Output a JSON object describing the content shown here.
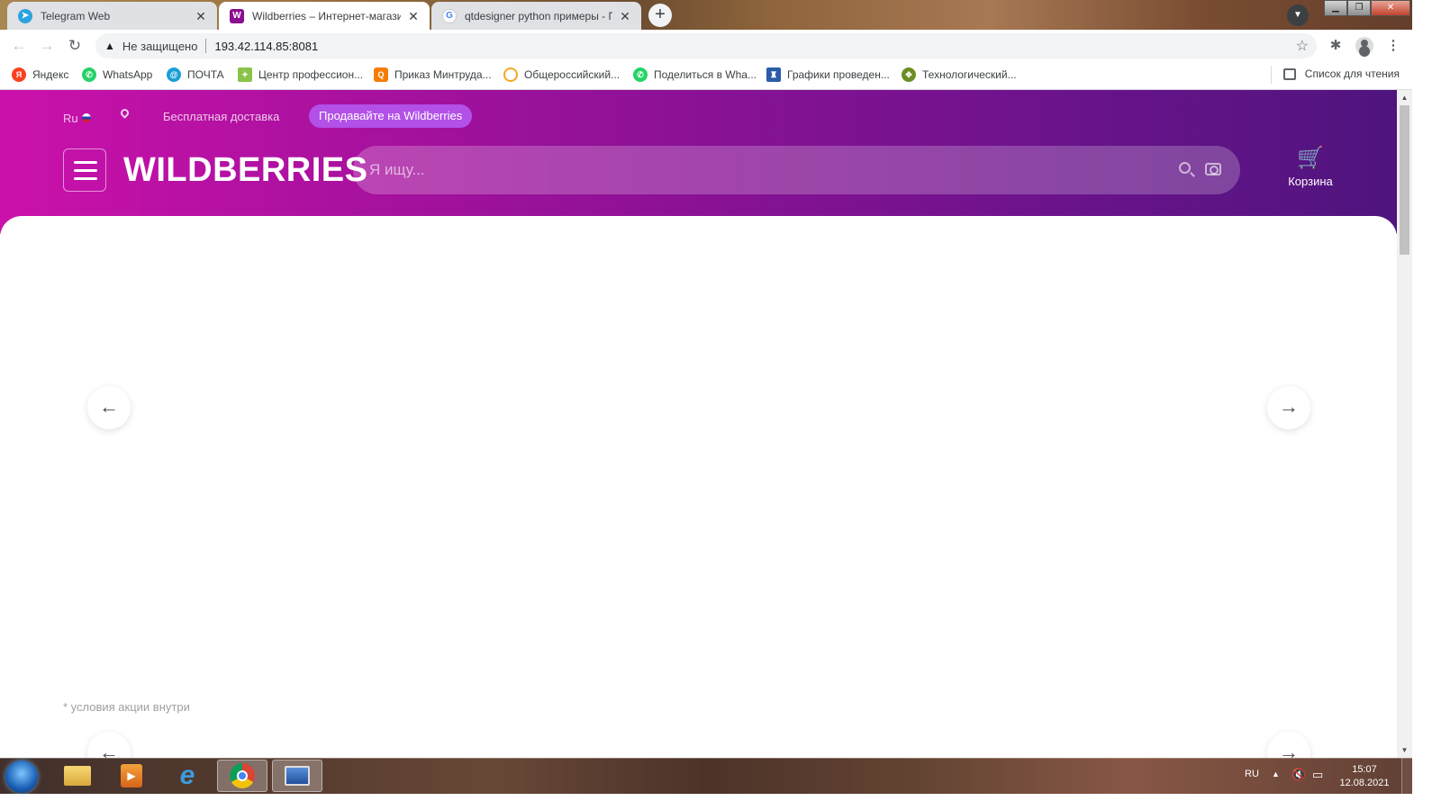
{
  "browser": {
    "tabs": [
      {
        "title": "Telegram Web",
        "favicon": "telegram-icon",
        "active": false
      },
      {
        "title": "Wildberries – Интернет-магазин",
        "favicon": "wildberries-icon",
        "active": true
      },
      {
        "title": "qtdesigner python примеры - П",
        "favicon": "google-icon",
        "active": false
      }
    ],
    "address": {
      "security_label": "Не защищено",
      "url": "193.42.114.85:8081"
    },
    "bookmarks": [
      {
        "label": "Яндекс",
        "icon": "yandex-icon",
        "color": "#fc3f1d"
      },
      {
        "label": "WhatsApp",
        "icon": "whatsapp-icon",
        "color": "#25d366"
      },
      {
        "label": "ПОЧТА",
        "icon": "mail-icon",
        "color": "#1a9fd6"
      },
      {
        "label": "Центр профессион...",
        "icon": "leaf-icon",
        "color": "#8bc34a"
      },
      {
        "label": "Приказ Минтруда...",
        "icon": "doc-icon",
        "color": "#f57c00"
      },
      {
        "label": "Общероссийский...",
        "icon": "search-icon",
        "color": "#f5a623"
      },
      {
        "label": "Поделиться в Wha...",
        "icon": "whatsapp-icon",
        "color": "#25d366"
      },
      {
        "label": "Графики проведен...",
        "icon": "emblem-icon",
        "color": "#2a5caa"
      },
      {
        "label": "Технологический...",
        "icon": "eagle-icon",
        "color": "#6b8e23"
      }
    ],
    "reading_list": "Список для чтения"
  },
  "site": {
    "lang": "Ru",
    "free_delivery": "Бесплатная доставка",
    "sell_button": "Продавайте на Wildberries",
    "logo": "WILDBERRIES",
    "search_placeholder": "Я ищу...",
    "cart_label": "Корзина",
    "promo_note": "* условия акции внутри",
    "arrow_prev": "←",
    "arrow_next": "→",
    "colors": {
      "gradient_start": "#cb11ab",
      "gradient_end": "#4f147e",
      "sell_button": "#b250e8"
    }
  },
  "taskbar": {
    "lang": "RU",
    "time": "15:07",
    "date": "12.08.2021"
  }
}
